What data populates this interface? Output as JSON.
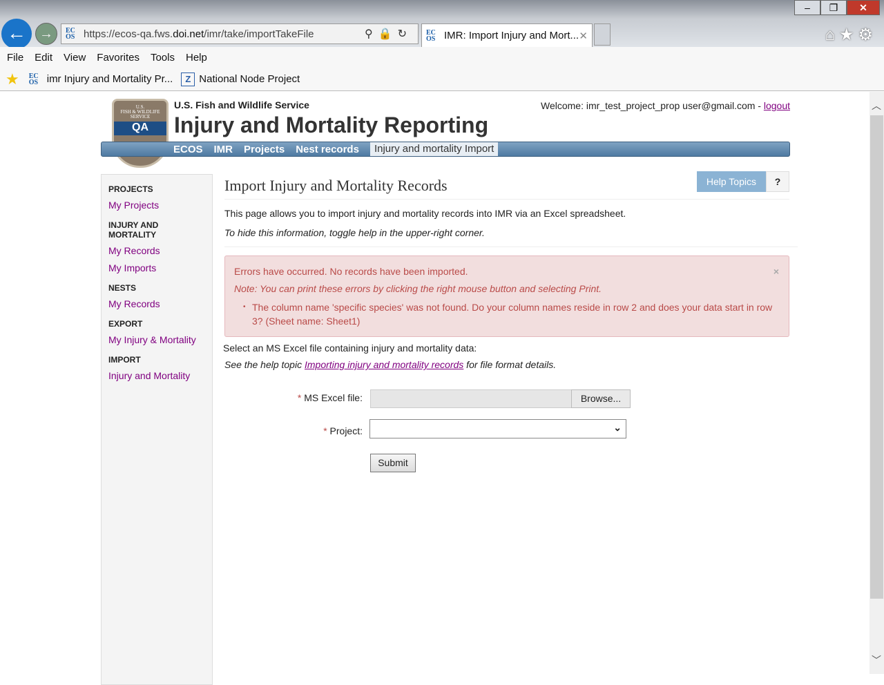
{
  "browser": {
    "url_prefix": "https://ecos-qa.fws.",
    "url_host": "doi.net",
    "url_path": "/imr/take/importTakeFile",
    "tab_title": "IMR: Import Injury and Mort...",
    "favicon_text": "EC OS",
    "menu": [
      "File",
      "Edit",
      "View",
      "Favorites",
      "Tools",
      "Help"
    ],
    "favorites": [
      {
        "label": "imr Injury and Mortality Pr..."
      },
      {
        "label": "National Node Project"
      }
    ],
    "icons": [
      "back-icon",
      "forward-icon",
      "search-icon",
      "lock-icon",
      "refresh-icon",
      "home-icon",
      "star-icon",
      "gear-icon"
    ]
  },
  "header": {
    "agency": "U.S. Fish and Wildlife Service",
    "title": "Injury and Mortality Reporting",
    "welcome": "Welcome: imr_test_project_prop user@gmail.com - ",
    "logout": "logout",
    "logo_text": "U.S. FISH & WILDLIFE SERVICE",
    "logo_badge": "QA",
    "breadcrumbs": [
      "ECOS",
      "IMR",
      "Projects",
      "Nest records",
      "Injury and mortality Import"
    ]
  },
  "sidebar": [
    {
      "heading": "PROJECTS",
      "links": [
        "My Projects"
      ]
    },
    {
      "heading": "INJURY AND MORTALITY",
      "links": [
        "My Records",
        "My Imports"
      ]
    },
    {
      "heading": "NESTS",
      "links": [
        "My Records"
      ]
    },
    {
      "heading": "EXPORT",
      "links": [
        "My Injury & Mortality"
      ]
    },
    {
      "heading": "IMPORT",
      "links": [
        "Injury and Mortality"
      ]
    }
  ],
  "main": {
    "title": "Import Injury and Mortality Records",
    "help_topics": "Help Topics",
    "help_toggle": "?",
    "intro": "This page allows you to import injury and mortality records into IMR via an Excel spreadsheet.",
    "intro_hint": "To hide this information, toggle help in the upper-right corner.",
    "alert": {
      "title": "Errors have occurred. No records have been imported.",
      "note": "Note: You can print these errors by clicking the right mouse button and selecting Print.",
      "errors": [
        "The column name 'specific species' was not found. Do your column names reside in row 2 and does your data start in row 3? (Sheet name: Sheet1)"
      ],
      "close": "×"
    },
    "select_text": "Select an MS Excel file containing injury and mortality data:",
    "see_help_pre": "See the help topic ",
    "see_help_link": "Importing injury and mortality records",
    "see_help_post": " for file format details.",
    "form": {
      "file_label": "MS Excel file:",
      "browse": "Browse...",
      "file_value": "",
      "project_label": "Project:",
      "project_value": "",
      "submit": "Submit",
      "required": "*"
    }
  },
  "colors": {
    "accent": "#4e7aa2",
    "alert_bg": "#f2dede",
    "alert_text": "#b94a48",
    "link": "#800080"
  }
}
